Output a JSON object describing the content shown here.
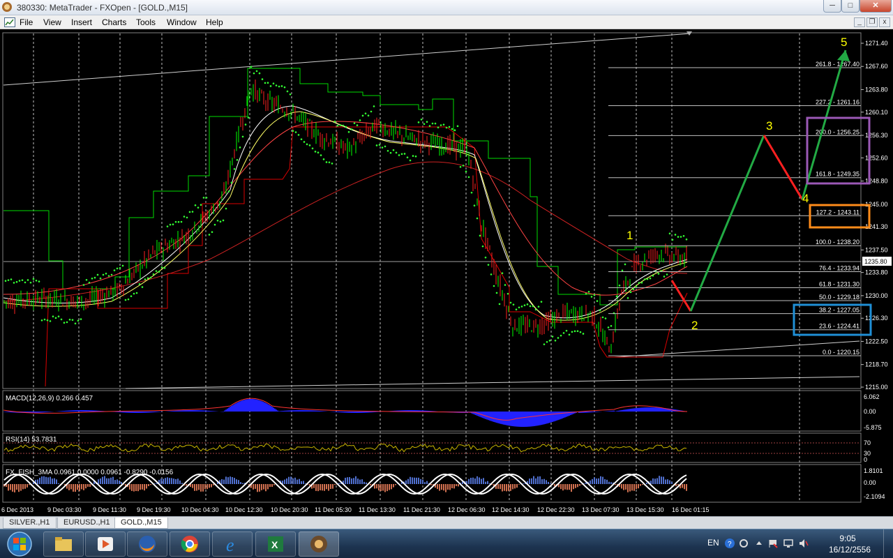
{
  "window": {
    "title": "380330: MetaTrader - FXOpen - [GOLD.,M15]",
    "controls": {
      "minimize": "─",
      "maximize": "□",
      "close": "✕"
    }
  },
  "menu": {
    "items": [
      "File",
      "View",
      "Insert",
      "Charts",
      "Tools",
      "Window",
      "Help"
    ],
    "mdi_controls": {
      "minimize": "_",
      "restore": "❐",
      "close": "x"
    }
  },
  "chart": {
    "symbol": "GOLD.",
    "timeframe": "M15",
    "price_scale": [
      "1271.40",
      "1267.60",
      "1263.80",
      "1260.10",
      "1256.30",
      "1252.60",
      "1248.80",
      "1245.00",
      "1241.30",
      "1237.50",
      "1233.80",
      "1230.00",
      "1226.30",
      "1222.50",
      "1218.70",
      "1215.00"
    ],
    "current_price": "1235.80",
    "time_labels": [
      "6 Dec 2013",
      "9 Dec 03:30",
      "9 Dec 11:30",
      "9 Dec 19:30",
      "10 Dec 04:30",
      "10 Dec 12:30",
      "10 Dec 20:30",
      "11 Dec 05:30",
      "11 Dec 13:30",
      "11 Dec 21:30",
      "12 Dec 06:30",
      "12 Dec 14:30",
      "12 Dec 22:30",
      "13 Dec 07:30",
      "13 Dec 15:30",
      "16 Dec 01:15"
    ],
    "fibo_levels": [
      {
        "label": "261.8 - 1267.40",
        "price": 1267.4
      },
      {
        "label": "227.2 - 1261.16",
        "price": 1261.16
      },
      {
        "label": "200.0 - 1256.25",
        "price": 1256.25
      },
      {
        "label": "161.8 - 1249.35",
        "price": 1249.35
      },
      {
        "label": "127.2 - 1243.11",
        "price": 1243.11
      },
      {
        "label": "100.0 - 1238.20",
        "price": 1238.2
      },
      {
        "label": "76.4 - 1233.94",
        "price": 1233.94
      },
      {
        "label": "61.8 - 1231.30",
        "price": 1231.3
      },
      {
        "label": "50.0 - 1229.18",
        "price": 1229.18
      },
      {
        "label": "38.2 - 1227.05",
        "price": 1227.05
      },
      {
        "label": "23.6 - 1224.41",
        "price": 1224.41
      },
      {
        "label": "0.0 - 1220.15",
        "price": 1220.15
      }
    ],
    "wave_labels": [
      "1",
      "2",
      "3",
      "4",
      "5"
    ],
    "colors": {
      "up_candle": "#00ff00",
      "down_candle": "#ff2020",
      "fibo": "#c0c0c0",
      "wave_up": "#22aa44",
      "wave_down": "#ff2020",
      "wave_label": "#ffff00",
      "box_purple": "#9b59b6",
      "box_orange": "#ff8c1a",
      "box_blue": "#1f8fd6"
    }
  },
  "indicators": {
    "macd": {
      "label": "MACD(12,26,9) 0.266 0.457",
      "scale": [
        "6.062",
        "0.00",
        "-5.875"
      ]
    },
    "rsi": {
      "label": "RSI(14) 53.7831",
      "scale": [
        "70",
        "30",
        "0"
      ]
    },
    "fisher": {
      "label": "FX_FISH_3MA 0.0961 0.0000 0.0961 -0.8290 -0.0156",
      "scale": [
        "1.8101",
        "0.00",
        "-2.1094"
      ]
    }
  },
  "tabs": [
    "SILVER.,H1",
    "EURUSD.,H1",
    "GOLD.,M15"
  ],
  "taskbar": {
    "apps": [
      "explorer-icon",
      "media-icon",
      "firefox-icon",
      "chrome-icon",
      "ie-icon",
      "excel-icon",
      "metatrader-icon"
    ],
    "language": "EN",
    "time": "9:05",
    "date": "16/12/2556"
  }
}
